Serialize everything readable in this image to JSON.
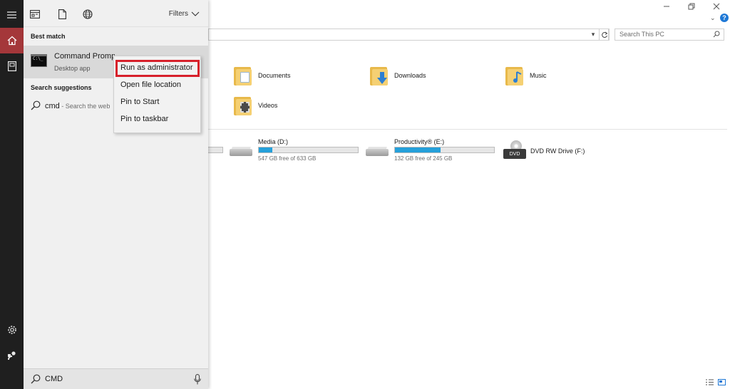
{
  "explorer": {
    "address_value": "",
    "search_placeholder": "Search This PC",
    "folders": [
      {
        "label": "Documents"
      },
      {
        "label": "Downloads"
      },
      {
        "label": "Music"
      },
      {
        "label": "Videos"
      }
    ],
    "drives": [
      {
        "name": "Media (D:)",
        "free": "547 GB free of 633 GB",
        "used_fraction": 0.14
      },
      {
        "name": "Productivity® (E:)",
        "free": "132 GB free of 245 GB",
        "used_fraction": 0.46
      }
    ],
    "dvd": {
      "name": "DVD RW Drive (F:)",
      "badge": "DVD"
    },
    "partial_drive_used_fraction": 0.8
  },
  "start": {
    "filters_label": "Filters",
    "best_match_title": "Best match",
    "best_match": {
      "title": "Command Prompt",
      "subtitle": "Desktop app",
      "icon_text": "C:\\_"
    },
    "suggestions_title": "Search suggestions",
    "suggestion": {
      "query": "cmd",
      "subtitle": " - Search the web"
    },
    "search_value": "CMD"
  },
  "context_menu": {
    "items": [
      {
        "label": "Run as administrator"
      },
      {
        "label": "Open file location"
      },
      {
        "label": "Pin to Start"
      },
      {
        "label": "Pin to taskbar"
      }
    ]
  },
  "colors": {
    "accent_red": "#a4373a",
    "highlight_border": "#d7202b",
    "drive_fill": "#26a0da"
  }
}
